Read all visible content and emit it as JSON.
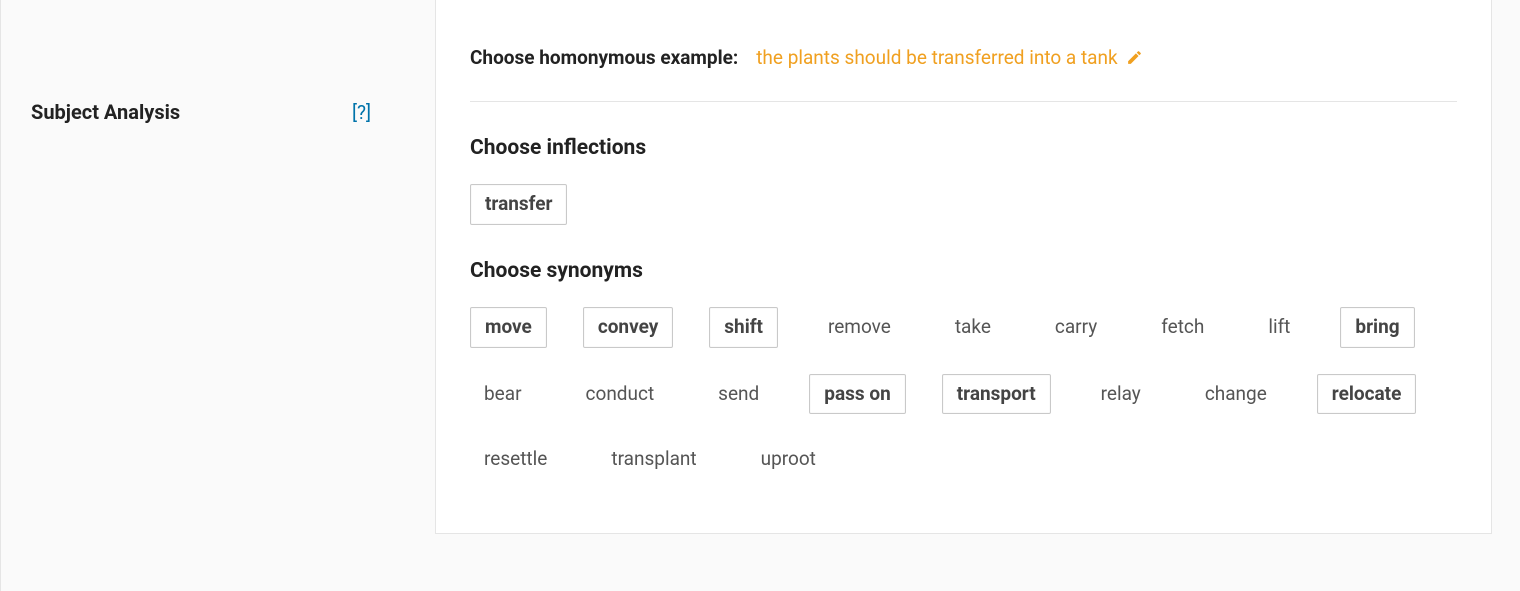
{
  "sidebar": {
    "heading": "Subject Analysis",
    "help_label": "[?]"
  },
  "main": {
    "example_label": "Choose homonymous example:",
    "example_text": "the plants should be transferred into a tank",
    "inflections_heading": "Choose inflections",
    "inflections": [
      {
        "label": "transfer",
        "selected": true
      }
    ],
    "synonyms_heading": "Choose synonyms",
    "synonyms": [
      {
        "label": "move",
        "selected": true
      },
      {
        "label": "convey",
        "selected": true
      },
      {
        "label": "shift",
        "selected": true
      },
      {
        "label": "remove",
        "selected": false
      },
      {
        "label": "take",
        "selected": false
      },
      {
        "label": "carry",
        "selected": false
      },
      {
        "label": "fetch",
        "selected": false
      },
      {
        "label": "lift",
        "selected": false
      },
      {
        "label": "bring",
        "selected": true
      },
      {
        "label": "bear",
        "selected": false
      },
      {
        "label": "conduct",
        "selected": false
      },
      {
        "label": "send",
        "selected": false
      },
      {
        "label": "pass on",
        "selected": true
      },
      {
        "label": "transport",
        "selected": true
      },
      {
        "label": "relay",
        "selected": false
      },
      {
        "label": "change",
        "selected": false
      },
      {
        "label": "relocate",
        "selected": true
      },
      {
        "label": "resettle",
        "selected": false
      },
      {
        "label": "transplant",
        "selected": false
      },
      {
        "label": "uproot",
        "selected": false
      }
    ]
  },
  "colors": {
    "accent_orange": "#f0a020",
    "help_blue": "#0073aa"
  }
}
